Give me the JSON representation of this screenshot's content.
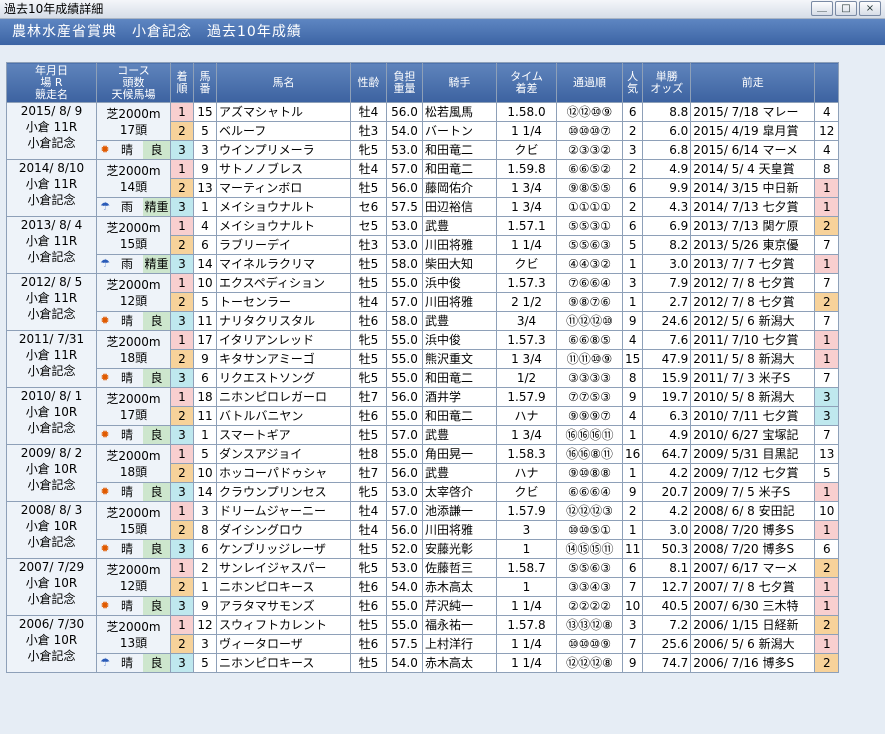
{
  "window": {
    "title": "過去10年成績詳細",
    "buttons": [
      "＿",
      "□",
      "×"
    ]
  },
  "header": {
    "title": "農林水産省賞典　小倉記念　過去10年成績"
  },
  "table": {
    "columns": [
      "年月日 場 R 競走名",
      "コース 頭数 天候馬場",
      "着順",
      "馬番",
      "馬名",
      "性齢",
      "負担重量",
      "騎手",
      "タイム着差",
      "通過順",
      "人気",
      "単勝オッズ",
      "前走",
      ""
    ],
    "races": [
      {
        "date": "2015/ 8/ 9",
        "venue": "小倉 11R",
        "race": "小倉記念",
        "course": "芝2000m",
        "heads": "17頭",
        "weather_icon": "sun-icon",
        "weather": "晴",
        "track": "良",
        "rows": [
          {
            "pos": "1",
            "num": "15",
            "horse": "アズマシャトル",
            "sexage": "牡4",
            "weight": "56.0",
            "jockey": "松若風馬",
            "time": "1.58.0",
            "passing": "⑫⑫⑩⑨",
            "pop": "6",
            "odds": "8.8",
            "prev": "2015/ 7/18 マレー",
            "prevpos": "4"
          },
          {
            "pos": "2",
            "num": "5",
            "horse": "ベルーフ",
            "sexage": "牡3",
            "weight": "54.0",
            "jockey": "バートン",
            "time": "1 1/4",
            "passing": "⑩⑩⑩⑦",
            "pop": "2",
            "odds": "6.0",
            "prev": "2015/ 4/19 皐月賞",
            "prevpos": "12"
          },
          {
            "pos": "3",
            "num": "3",
            "horse": "ウインプリメーラ",
            "sexage": "牝5",
            "weight": "53.0",
            "jockey": "和田竜二",
            "time": "クビ",
            "passing": "②③③②",
            "pop": "3",
            "odds": "6.8",
            "prev": "2015/ 6/14 マーメ",
            "prevpos": "4"
          }
        ]
      },
      {
        "date": "2014/ 8/10",
        "venue": "小倉 11R",
        "race": "小倉記念",
        "course": "芝2000m",
        "heads": "14頭",
        "weather_icon": "umbrella-icon",
        "weather": "雨",
        "track": "精重",
        "rows": [
          {
            "pos": "1",
            "num": "9",
            "horse": "サトノノブレス",
            "sexage": "牡4",
            "weight": "57.0",
            "jockey": "和田竜二",
            "time": "1.59.8",
            "passing": "⑥⑥⑤②",
            "pop": "2",
            "odds": "4.9",
            "prev": "2014/ 5/ 4 天皇賞",
            "prevpos": "8"
          },
          {
            "pos": "2",
            "num": "13",
            "horse": "マーティンボロ",
            "sexage": "牡5",
            "weight": "56.0",
            "jockey": "藤岡佑介",
            "time": "1 3/4",
            "passing": "⑨⑧⑤⑤",
            "pop": "6",
            "odds": "9.9",
            "prev": "2014/ 3/15 中日新",
            "prevpos": "1"
          },
          {
            "pos": "3",
            "num": "1",
            "horse": "メイショウナルト",
            "sexage": "セ6",
            "weight": "57.5",
            "jockey": "田辺裕信",
            "time": "1 3/4",
            "passing": "①①①①",
            "pop": "2",
            "odds": "4.3",
            "prev": "2014/ 7/13 七夕賞",
            "prevpos": "1"
          }
        ]
      },
      {
        "date": "2013/ 8/ 4",
        "venue": "小倉 11R",
        "race": "小倉記念",
        "course": "芝2000m",
        "heads": "15頭",
        "weather_icon": "umbrella-icon",
        "weather": "雨",
        "track": "精重",
        "rows": [
          {
            "pos": "1",
            "num": "4",
            "horse": "メイショウナルト",
            "sexage": "セ5",
            "weight": "53.0",
            "jockey": "武豊",
            "time": "1.57.1",
            "passing": "⑤⑤③①",
            "pop": "6",
            "odds": "6.9",
            "prev": "2013/ 7/13 関ケ原",
            "prevpos": "2"
          },
          {
            "pos": "2",
            "num": "6",
            "horse": "ラブリーデイ",
            "sexage": "牡3",
            "weight": "53.0",
            "jockey": "川田将雅",
            "time": "1 1/4",
            "passing": "⑤⑤⑥③",
            "pop": "5",
            "odds": "8.2",
            "prev": "2013/ 5/26 東京優",
            "prevpos": "7"
          },
          {
            "pos": "3",
            "num": "14",
            "horse": "マイネルラクリマ",
            "sexage": "牡5",
            "weight": "58.0",
            "jockey": "柴田大知",
            "time": "クビ",
            "passing": "④④③②",
            "pop": "1",
            "odds": "3.0",
            "prev": "2013/ 7/ 7 七夕賞",
            "prevpos": "1"
          }
        ]
      },
      {
        "date": "2012/ 8/ 5",
        "venue": "小倉 11R",
        "race": "小倉記念",
        "course": "芝2000m",
        "heads": "12頭",
        "weather_icon": "sun-icon",
        "weather": "晴",
        "track": "良",
        "rows": [
          {
            "pos": "1",
            "num": "10",
            "horse": "エクスペディション",
            "sexage": "牡5",
            "weight": "55.0",
            "jockey": "浜中俊",
            "time": "1.57.3",
            "passing": "⑦⑥⑥④",
            "pop": "3",
            "odds": "7.9",
            "prev": "2012/ 7/ 8 七夕賞",
            "prevpos": "7"
          },
          {
            "pos": "2",
            "num": "5",
            "horse": "トーセンラー",
            "sexage": "牡4",
            "weight": "57.0",
            "jockey": "川田将雅",
            "time": "2 1/2",
            "passing": "⑨⑧⑦⑥",
            "pop": "1",
            "odds": "2.7",
            "prev": "2012/ 7/ 8 七夕賞",
            "prevpos": "2"
          },
          {
            "pos": "3",
            "num": "11",
            "horse": "ナリタクリスタル",
            "sexage": "牡6",
            "weight": "58.0",
            "jockey": "武豊",
            "time": "3/4",
            "passing": "⑪⑫⑫⑩",
            "pop": "9",
            "odds": "24.6",
            "prev": "2012/ 5/ 6 新潟大",
            "prevpos": "7"
          }
        ]
      },
      {
        "date": "2011/ 7/31",
        "venue": "小倉 11R",
        "race": "小倉記念",
        "course": "芝2000m",
        "heads": "18頭",
        "weather_icon": "sun-icon",
        "weather": "晴",
        "track": "良",
        "rows": [
          {
            "pos": "1",
            "num": "17",
            "horse": "イタリアンレッド",
            "sexage": "牝5",
            "weight": "55.0",
            "jockey": "浜中俊",
            "time": "1.57.3",
            "passing": "⑥⑥⑧⑤",
            "pop": "4",
            "odds": "7.6",
            "prev": "2011/ 7/10 七夕賞",
            "prevpos": "1"
          },
          {
            "pos": "2",
            "num": "9",
            "horse": "キタサンアミーゴ",
            "sexage": "牡5",
            "weight": "55.0",
            "jockey": "熊沢重文",
            "time": "1 3/4",
            "passing": "⑪⑪⑩⑨",
            "pop": "15",
            "odds": "47.9",
            "prev": "2011/ 5/ 8 新潟大",
            "prevpos": "1"
          },
          {
            "pos": "3",
            "num": "6",
            "horse": "リクエストソング",
            "sexage": "牝5",
            "weight": "55.0",
            "jockey": "和田竜二",
            "time": "1/2",
            "passing": "③③③③",
            "pop": "8",
            "odds": "15.9",
            "prev": "2011/ 7/ 3 米子S",
            "prevpos": "7"
          }
        ]
      },
      {
        "date": "2010/ 8/ 1",
        "venue": "小倉 10R",
        "race": "小倉記念",
        "course": "芝2000m",
        "heads": "17頭",
        "weather_icon": "sun-icon",
        "weather": "晴",
        "track": "良",
        "rows": [
          {
            "pos": "1",
            "num": "18",
            "horse": "ニホンピロレガーロ",
            "sexage": "牡7",
            "weight": "56.0",
            "jockey": "酒井学",
            "time": "1.57.9",
            "passing": "⑦⑦⑤③",
            "pop": "9",
            "odds": "19.7",
            "prev": "2010/ 5/ 8 新潟大",
            "prevpos": "3"
          },
          {
            "pos": "2",
            "num": "11",
            "horse": "バトルバニヤン",
            "sexage": "牡6",
            "weight": "55.0",
            "jockey": "和田竜二",
            "time": "ハナ",
            "passing": "⑨⑨⑨⑦",
            "pop": "4",
            "odds": "6.3",
            "prev": "2010/ 7/11 七夕賞",
            "prevpos": "3"
          },
          {
            "pos": "3",
            "num": "1",
            "horse": "スマートギア",
            "sexage": "牡5",
            "weight": "57.0",
            "jockey": "武豊",
            "time": "1 3/4",
            "passing": "⑯⑯⑯⑪",
            "pop": "1",
            "odds": "4.9",
            "prev": "2010/ 6/27 宝塚記",
            "prevpos": "7"
          }
        ]
      },
      {
        "date": "2009/ 8/ 2",
        "venue": "小倉 10R",
        "race": "小倉記念",
        "course": "芝2000m",
        "heads": "18頭",
        "weather_icon": "sun-icon",
        "weather": "晴",
        "track": "良",
        "rows": [
          {
            "pos": "1",
            "num": "5",
            "horse": "ダンスアジョイ",
            "sexage": "牡8",
            "weight": "55.0",
            "jockey": "角田晃一",
            "time": "1.58.3",
            "passing": "⑯⑯⑧⑪",
            "pop": "16",
            "odds": "64.7",
            "prev": "2009/ 5/31 目黒記",
            "prevpos": "13"
          },
          {
            "pos": "2",
            "num": "10",
            "horse": "ホッコーパドゥシャ",
            "sexage": "牡7",
            "weight": "56.0",
            "jockey": "武豊",
            "time": "ハナ",
            "passing": "⑨⑩⑧⑧",
            "pop": "1",
            "odds": "4.2",
            "prev": "2009/ 7/12 七夕賞",
            "prevpos": "5"
          },
          {
            "pos": "3",
            "num": "14",
            "horse": "クラウンプリンセス",
            "sexage": "牝5",
            "weight": "53.0",
            "jockey": "太宰啓介",
            "time": "クビ",
            "passing": "⑥⑥⑥④",
            "pop": "9",
            "odds": "20.7",
            "prev": "2009/ 7/ 5 米子S",
            "prevpos": "1"
          }
        ]
      },
      {
        "date": "2008/ 8/ 3",
        "venue": "小倉 10R",
        "race": "小倉記念",
        "course": "芝2000m",
        "heads": "15頭",
        "weather_icon": "sun-icon",
        "weather": "晴",
        "track": "良",
        "rows": [
          {
            "pos": "1",
            "num": "3",
            "horse": "ドリームジャーニー",
            "sexage": "牡4",
            "weight": "57.0",
            "jockey": "池添謙一",
            "time": "1.57.9",
            "passing": "⑫⑫⑫③",
            "pop": "2",
            "odds": "4.2",
            "prev": "2008/ 6/ 8 安田記",
            "prevpos": "10"
          },
          {
            "pos": "2",
            "num": "8",
            "horse": "ダイシングロウ",
            "sexage": "牡4",
            "weight": "56.0",
            "jockey": "川田将雅",
            "time": "3",
            "passing": "⑩⑩⑤①",
            "pop": "1",
            "odds": "3.0",
            "prev": "2008/ 7/20 博多S",
            "prevpos": "1"
          },
          {
            "pos": "3",
            "num": "6",
            "horse": "ケンブリッジレーザ",
            "sexage": "牡5",
            "weight": "52.0",
            "jockey": "安藤光彰",
            "time": "1",
            "passing": "⑭⑮⑮⑪",
            "pop": "11",
            "odds": "50.3",
            "prev": "2008/ 7/20 博多S",
            "prevpos": "6"
          }
        ]
      },
      {
        "date": "2007/ 7/29",
        "venue": "小倉 10R",
        "race": "小倉記念",
        "course": "芝2000m",
        "heads": "12頭",
        "weather_icon": "sun-icon",
        "weather": "晴",
        "track": "良",
        "rows": [
          {
            "pos": "1",
            "num": "2",
            "horse": "サンレイジャスパー",
            "sexage": "牝5",
            "weight": "53.0",
            "jockey": "佐藤哲三",
            "time": "1.58.7",
            "passing": "⑤⑤⑥③",
            "pop": "6",
            "odds": "8.1",
            "prev": "2007/ 6/17 マーメ",
            "prevpos": "2"
          },
          {
            "pos": "2",
            "num": "1",
            "horse": "ニホンピロキース",
            "sexage": "牡6",
            "weight": "54.0",
            "jockey": "赤木高太",
            "time": "1",
            "passing": "③③④③",
            "pop": "7",
            "odds": "12.7",
            "prev": "2007/ 7/ 8 七夕賞",
            "prevpos": "1"
          },
          {
            "pos": "3",
            "num": "9",
            "horse": "アラタマサモンズ",
            "sexage": "牡6",
            "weight": "55.0",
            "jockey": "芹沢純一",
            "time": "1 1/4",
            "passing": "②②②②",
            "pop": "10",
            "odds": "40.5",
            "prev": "2007/ 6/30 三木特",
            "prevpos": "1"
          }
        ]
      },
      {
        "date": "2006/ 7/30",
        "venue": "小倉 10R",
        "race": "小倉記念",
        "course": "芝2000m",
        "heads": "13頭",
        "weather_icon": "umbrella-icon",
        "weather": "晴",
        "track": "良",
        "rows": [
          {
            "pos": "1",
            "num": "12",
            "horse": "スウィフトカレント",
            "sexage": "牡5",
            "weight": "55.0",
            "jockey": "福永祐一",
            "time": "1.57.8",
            "passing": "⑬⑬⑫⑧",
            "pop": "3",
            "odds": "7.2",
            "prev": "2006/ 1/15 日経新",
            "prevpos": "2"
          },
          {
            "pos": "2",
            "num": "3",
            "horse": "ヴィータローザ",
            "sexage": "牡6",
            "weight": "57.5",
            "jockey": "上村洋行",
            "time": "1 1/4",
            "passing": "⑩⑩⑩⑨",
            "pop": "7",
            "odds": "25.6",
            "prev": "2006/ 5/ 6 新潟大",
            "prevpos": "1"
          },
          {
            "pos": "3",
            "num": "5",
            "horse": "ニホンピロキース",
            "sexage": "牡5",
            "weight": "54.0",
            "jockey": "赤木高太",
            "time": "1 1/4",
            "passing": "⑫⑫⑫⑧",
            "pop": "9",
            "odds": "74.7",
            "prev": "2006/ 7/16 博多S",
            "prevpos": "2"
          }
        ]
      }
    ]
  },
  "colors": {
    "header_bg": "#4a72b0",
    "pos1": "#f8cfcf",
    "pos2": "#f7d29a",
    "pos3": "#bfe8ee",
    "track_bg": "#cde6cd",
    "border": "#8ea0b8"
  }
}
